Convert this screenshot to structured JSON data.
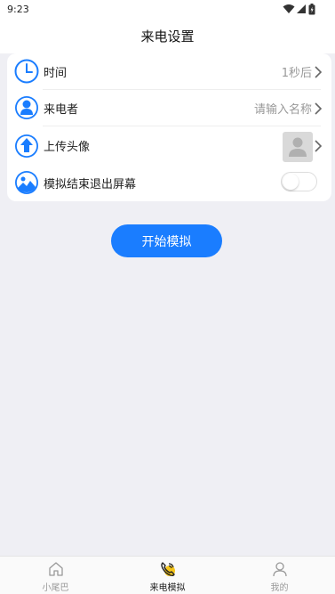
{
  "status_bar": {
    "time": "9:23"
  },
  "page": {
    "title": "来电设置"
  },
  "settings": {
    "time": {
      "label": "时间",
      "value": "1秒后"
    },
    "caller": {
      "label": "来电者",
      "placeholder": "请输入名称"
    },
    "avatar": {
      "label": "上传头像"
    },
    "exit_screen": {
      "label": "模拟结束退出屏幕",
      "enabled": false
    }
  },
  "actions": {
    "start_label": "开始模拟"
  },
  "tabs": [
    {
      "label": "小尾巴",
      "icon": "home-icon",
      "active": false
    },
    {
      "label": "来电模拟",
      "icon": "phone-call-icon",
      "active": true
    },
    {
      "label": "我的",
      "icon": "user-icon",
      "active": false
    }
  ],
  "colors": {
    "accent": "#1a7dff",
    "background": "#efeff4",
    "tab_active_icon": "#f5c518"
  }
}
